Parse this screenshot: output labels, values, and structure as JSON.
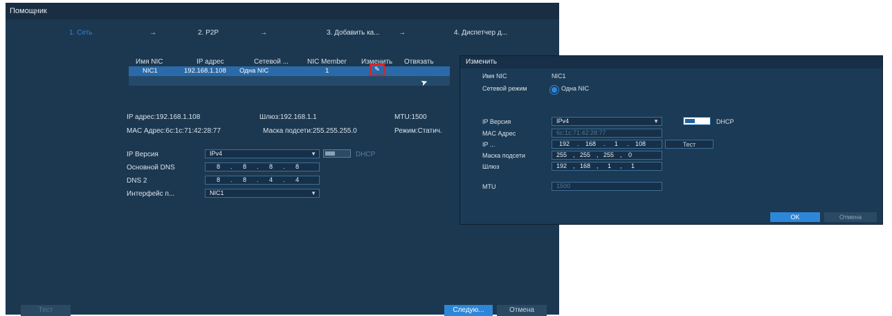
{
  "window": {
    "title": "Помощник"
  },
  "steps": [
    {
      "label": "1. Сеть"
    },
    {
      "label": "→"
    },
    {
      "label": "2. P2P"
    },
    {
      "label": "→"
    },
    {
      "label": "3. Добавить ка..."
    },
    {
      "label": "→"
    },
    {
      "label": "4. Диспетчер д..."
    }
  ],
  "nic_table": {
    "headers": [
      "Имя NIC",
      "IP адрес",
      "Сетевой ...",
      "NIC Member",
      "Изменить",
      "Отвязать"
    ],
    "row": {
      "name": "NIC1",
      "ip": "192.168.1.108",
      "mode": "Одна NIC",
      "member": "1"
    }
  },
  "info": {
    "ip": "IP адрес:192.168.1.108",
    "gateway": "Шлюз:192.168.1.1",
    "mtu": "MTU:1500",
    "mac": "MAC Адрес:6c:1c:71:42:28:77",
    "mask": "Маска подсети:255.255.255.0",
    "mode": "Режим:Статич."
  },
  "form": {
    "ip_version_label": "IP Версия",
    "ip_version_value": "IPv4",
    "dhcp_label": "DHCP",
    "dns1_label": "Основной DNS",
    "dns1": [
      "8",
      "8",
      "8",
      "8"
    ],
    "dns2_label": "DNS 2",
    "dns2": [
      "8",
      "8",
      "4",
      "4"
    ],
    "iface_label": "Интерфейс п...",
    "iface_value": "NIC1"
  },
  "bottom": {
    "test": "Тест",
    "next": "Следую...",
    "cancel": "Отмена"
  },
  "dialog": {
    "title": "Изменить",
    "nic_name_label": "Имя NIC",
    "nic_name": "NIC1",
    "net_mode_label": "Сетевой режим",
    "net_mode_value": "Одна NIC",
    "ip_version_label": "IP Версия",
    "ip_version_value": "IPv4",
    "dhcp_label": "DHCP",
    "mac_label": "MAC Адрес",
    "mac_value": "6c:1c:71:42:28:77",
    "ip_label": "IP ...",
    "ip": [
      "192",
      "168",
      "1",
      "108"
    ],
    "test_button": "Тест",
    "mask_label": "Маска подсети",
    "mask": [
      "255",
      "255",
      "255",
      "0"
    ],
    "gw_label": "Шлюз",
    "gw": [
      "192",
      "168",
      "1",
      "1"
    ],
    "mtu_label": "MTU",
    "mtu_value": "1500",
    "ok": "OK",
    "cancel": "Отмена"
  },
  "colors": {
    "panel": "#1c3850",
    "accent": "#2e86d8",
    "highlight": "#e02020"
  }
}
